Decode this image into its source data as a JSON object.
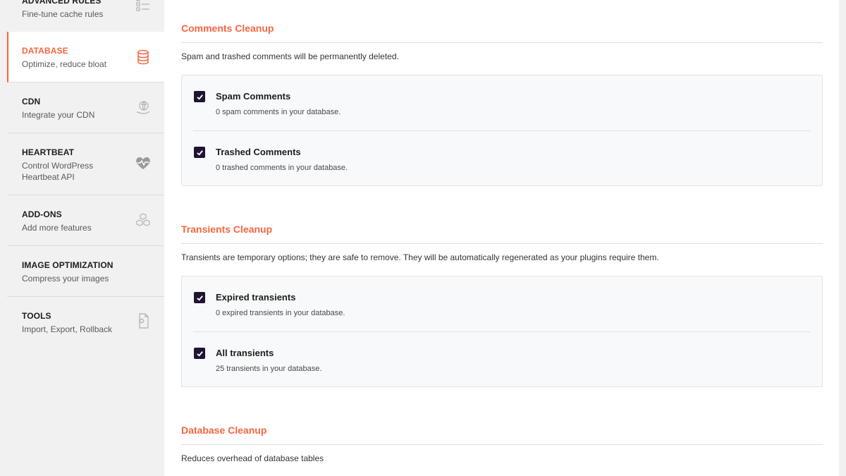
{
  "sidebar": {
    "items": [
      {
        "title": "ADVANCED RULES",
        "subtitle": "Fine-tune cache rules",
        "icon": "list-icon",
        "active": false
      },
      {
        "title": "DATABASE",
        "subtitle": "Optimize, reduce bloat",
        "icon": "database-icon",
        "active": true
      },
      {
        "title": "CDN",
        "subtitle": "Integrate your CDN",
        "icon": "globe-hand-icon",
        "active": false
      },
      {
        "title": "HEARTBEAT",
        "subtitle_line1": "Control WordPress",
        "subtitle_line2": "Heartbeat API",
        "icon": "heartbeat-icon",
        "active": false
      },
      {
        "title": "ADD-ONS",
        "subtitle": "Add more features",
        "icon": "cubes-icon",
        "active": false
      },
      {
        "title": "IMAGE OPTIMIZATION",
        "subtitle": "Compress your images",
        "icon": "",
        "active": false
      },
      {
        "title": "TOOLS",
        "subtitle": "Import, Export, Rollback",
        "icon": "file-gear-icon",
        "active": false
      }
    ]
  },
  "sections": {
    "comments": {
      "title": "Comments Cleanup",
      "description": "Spam and trashed comments will be permanently deleted.",
      "options": [
        {
          "label": "Spam Comments",
          "desc": "0 spam comments in your database.",
          "checked": true
        },
        {
          "label": "Trashed Comments",
          "desc": "0 trashed comments in your database.",
          "checked": true
        }
      ]
    },
    "transients": {
      "title": "Transients Cleanup",
      "description": "Transients are temporary options; they are safe to remove. They will be automatically regenerated as your plugins require them.",
      "options": [
        {
          "label": "Expired transients",
          "desc": "0 expired transients in your database.",
          "checked": true
        },
        {
          "label": "All transients",
          "desc": "25 transients in your database.",
          "checked": true
        }
      ]
    },
    "database": {
      "title": "Database Cleanup",
      "description": "Reduces overhead of database tables"
    }
  },
  "colors": {
    "accent": "#f56640",
    "checkbox": "#1f1432",
    "sidebar_bg": "#f1f1f1",
    "card_bg": "#f8f9fa"
  }
}
